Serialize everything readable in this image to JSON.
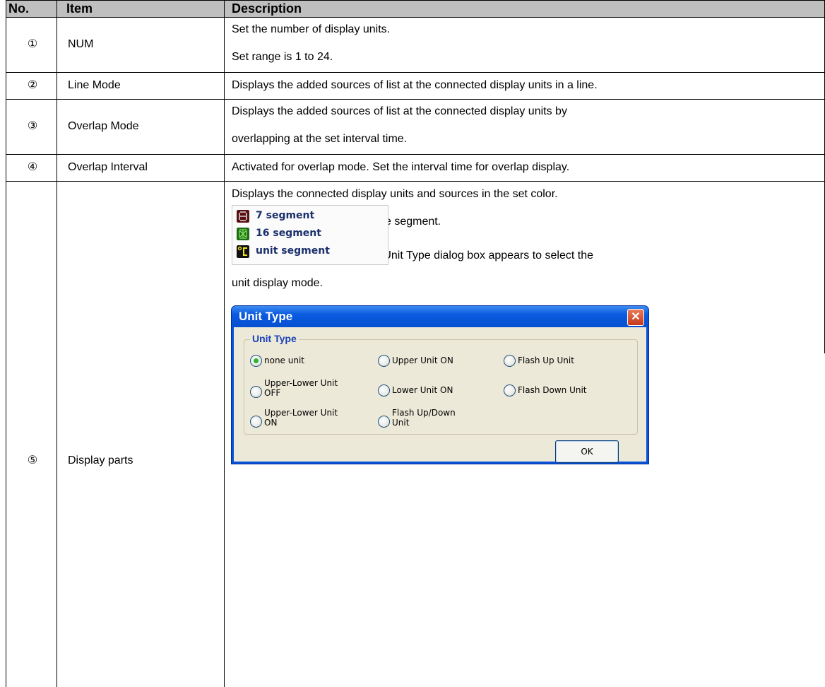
{
  "table": {
    "headers": {
      "no": "No.",
      "item": "Item",
      "description": "Description"
    },
    "rows": [
      {
        "no": "①",
        "item": "NUM",
        "desc": [
          "Set the number of display units.",
          "Set range is 1 to 24."
        ]
      },
      {
        "no": "②",
        "item": "Line Mode",
        "desc": [
          "Displays the added sources of list at the connected display units in a line."
        ]
      },
      {
        "no": "③",
        "item": "Overlap Mode",
        "desc": [
          "Displays the added sources of list at the connected display units by",
          "overlapping at the set interval time."
        ]
      },
      {
        "no": "④",
        "item": "Overlap Interval",
        "desc": [
          "Activated for overlap mode. Set the interval time for overlap display."
        ]
      },
      {
        "no": "⑤",
        "item": "Display parts",
        "desc": [
          "Displays the connected display units and sources in the set color.",
          "Right-click this part to select the segment.",
          "When selecting unit segment, Unit Type dialog box appears to select the",
          "unit display mode."
        ]
      }
    ]
  },
  "segment_menu": {
    "items": [
      {
        "label": "7 segment",
        "icon": "seven-segment-icon",
        "icon_color": "#5a0f12"
      },
      {
        "label": "16 segment",
        "icon": "sixteen-segment-icon",
        "icon_color": "#1f6b1a"
      },
      {
        "label": "unit segment",
        "icon": "unit-segment-icon",
        "icon_color": "#111111"
      }
    ]
  },
  "dialog": {
    "title": "Unit Type",
    "group_title": "Unit Type",
    "options": [
      {
        "label": "none unit",
        "selected": true
      },
      {
        "label": "Upper Unit ON",
        "selected": false
      },
      {
        "label": "Flash Up Unit",
        "selected": false
      },
      {
        "label_line1": "Upper-Lower Unit",
        "label_line2": "OFF",
        "selected": false
      },
      {
        "label": "Lower Unit ON",
        "selected": false
      },
      {
        "label": "Flash Down Unit",
        "selected": false
      },
      {
        "label_line1": "Upper-Lower Unit",
        "label_line2": "ON",
        "selected": false
      },
      {
        "label_line1": "Flash Up/Down",
        "label_line2": "Unit",
        "selected": false
      }
    ],
    "ok_label": "OK",
    "close_icon": "close-icon"
  }
}
